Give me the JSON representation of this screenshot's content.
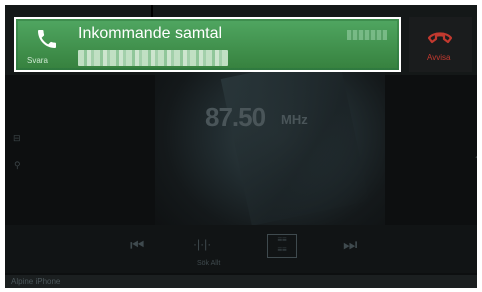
{
  "incoming_call": {
    "title": "Inkommande samtal",
    "answer_label": "Svara",
    "decline_label": "Avvisa"
  },
  "radio": {
    "frequency": "87.50",
    "unit": "MHz",
    "seek_label": "Sök Allt"
  },
  "footer": {
    "device": "Alpine iPhone"
  },
  "colors": {
    "banner_green": "#3f8f4e",
    "decline_red": "#c2392f"
  }
}
